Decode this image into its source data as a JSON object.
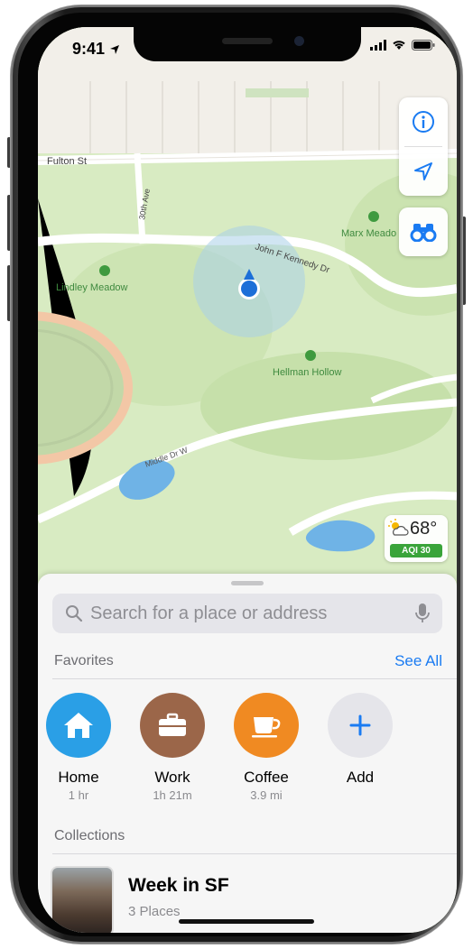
{
  "status_bar": {
    "time": "9:41"
  },
  "map": {
    "labels": {
      "fulton_st": "Fulton St",
      "30th_ave": "30th Ave",
      "jfk_dr": "John F Kennedy Dr",
      "lindley_meadow": "Lindley Meadow",
      "marx_meadow": "Marx Meado",
      "hellman_hollow": "Hellman Hollow",
      "middle_dr_w": "Middle Dr W"
    }
  },
  "map_controls": {
    "info_icon": "info-icon",
    "location_icon": "location-arrow-icon",
    "lookaround_icon": "binoculars-icon"
  },
  "weather": {
    "temp": "68°",
    "aqi": "AQI 30",
    "icon": "partly-sunny-icon"
  },
  "search": {
    "placeholder": "Search for a place or address"
  },
  "favorites": {
    "heading": "Favorites",
    "see_all": "See All",
    "items": [
      {
        "label": "Home",
        "sub": "1 hr",
        "color": "#2a9fe6",
        "icon": "house-icon"
      },
      {
        "label": "Work",
        "sub": "1h 21m",
        "color": "#9b6649",
        "icon": "briefcase-icon"
      },
      {
        "label": "Coffee",
        "sub": "3.9 mi",
        "color": "#f08a22",
        "icon": "coffee-cup-icon"
      },
      {
        "label": "Add",
        "sub": "",
        "color": "#e5e5ea",
        "icon": "plus-icon"
      }
    ]
  },
  "collections": {
    "heading": "Collections",
    "items": [
      {
        "title": "Week in SF",
        "sub": "3 Places"
      }
    ]
  }
}
